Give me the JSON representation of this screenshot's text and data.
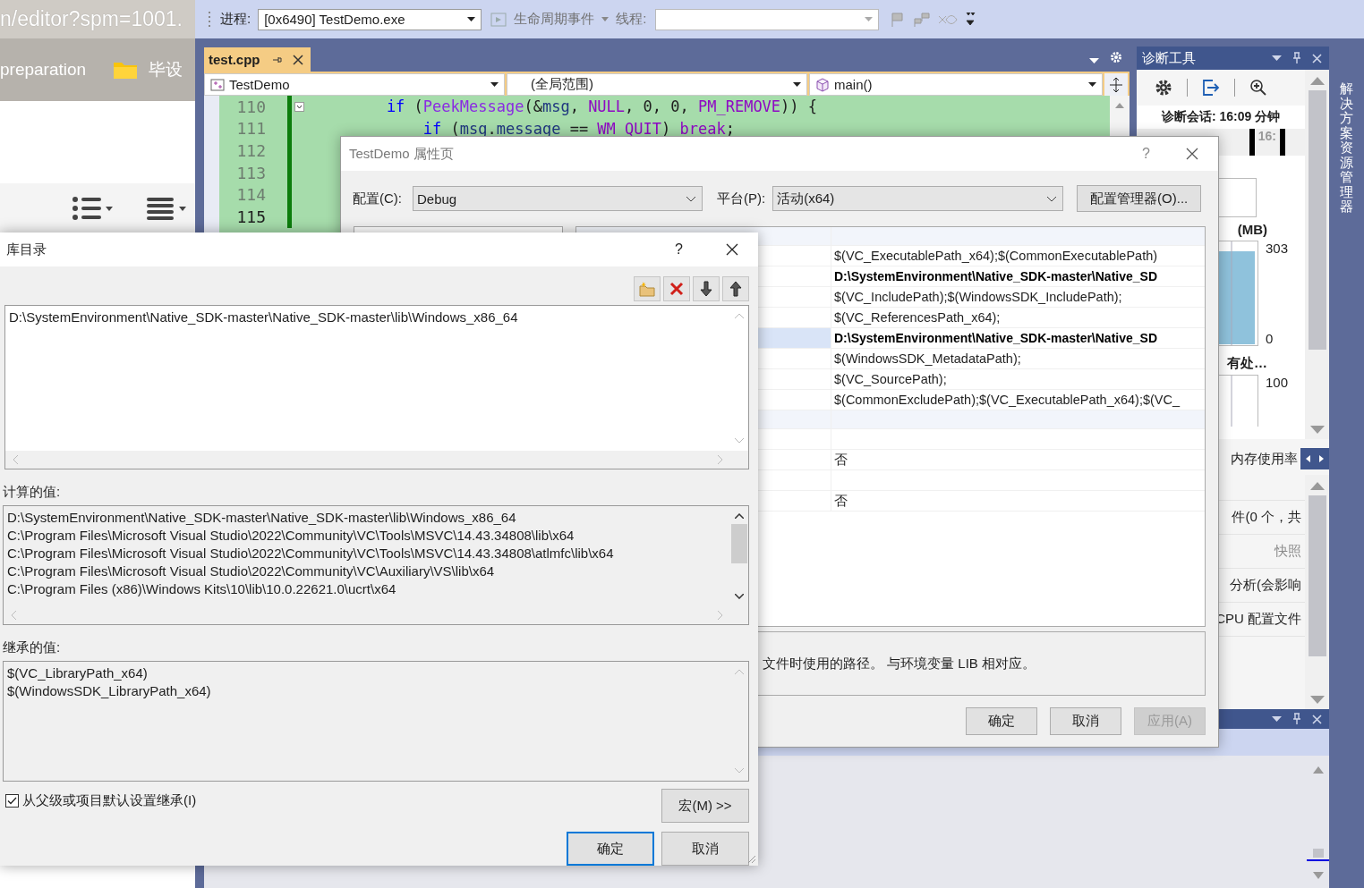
{
  "browser": {
    "url": "n/editor?spm=1001.",
    "bookmarks": [
      {
        "label": "preparation",
        "kind": "text"
      },
      {
        "label": "毕设",
        "kind": "folder"
      }
    ]
  },
  "vs": {
    "toolbar": {
      "process_label": "进程:",
      "process_value": "[0x6490] TestDemo.exe",
      "lifecycle": "生命周期事件",
      "thread_label": "线程:"
    },
    "tabs": [
      {
        "label": "test.cpp",
        "selected": true
      }
    ],
    "nav": {
      "project": "TestDemo",
      "scope": "(全局范围)",
      "member": "main()"
    },
    "code": [
      {
        "line": "110",
        "current": false,
        "tokens": [
          {
            "text": "if",
            "kind": "keyword"
          },
          {
            "text": " (",
            "kind": "plain"
          },
          {
            "text": "PeekMessage",
            "kind": "function"
          },
          {
            "text": "(&",
            "kind": "plain"
          },
          {
            "text": "msg",
            "kind": "variable"
          },
          {
            "text": ", ",
            "kind": "plain"
          },
          {
            "text": "NULL",
            "kind": "macro"
          },
          {
            "text": ", 0, 0, ",
            "kind": "plain"
          },
          {
            "text": "PM_REMOVE",
            "kind": "macro"
          },
          {
            "text": ")) {",
            "kind": "plain"
          }
        ]
      },
      {
        "line": "111",
        "current": false,
        "tokens": [
          {
            "text": "if",
            "kind": "keyword"
          },
          {
            "text": " (",
            "kind": "plain"
          },
          {
            "text": "msg",
            "kind": "variable"
          },
          {
            "text": ".",
            "kind": "plain"
          },
          {
            "text": "message",
            "kind": "variable"
          },
          {
            "text": " == ",
            "kind": "plain"
          },
          {
            "text": "WM_QUIT",
            "kind": "macro"
          },
          {
            "text": ") ",
            "kind": "plain"
          },
          {
            "text": "break",
            "kind": "control"
          },
          {
            "text": ";",
            "kind": "plain"
          }
        ]
      },
      {
        "line": "112",
        "current": false
      },
      {
        "line": "113",
        "current": false
      },
      {
        "line": "114",
        "current": false
      },
      {
        "line": "115",
        "current": true
      }
    ],
    "diagnostics": {
      "title": "诊断工具",
      "session": "诊断会话: 16:09 分钟",
      "timeline_label": "16:",
      "memory_label": "(MB)",
      "memory_max": "303",
      "memory_min": "0",
      "cpu_label": "有处…",
      "cpu_max": "100",
      "tab": "内存使用率",
      "items": [
        {
          "label": "件(0 个，共",
          "disabled": false
        },
        {
          "label": "快照",
          "disabled": true
        },
        {
          "label": "分析(会影响",
          "disabled": false
        },
        {
          "label": "CPU 配置文件",
          "disabled": false
        }
      ]
    },
    "side_tab": "解决方案资源管理器"
  },
  "properties": {
    "title": "TestDemo 属性页",
    "help": "?",
    "config_label": "配置(C):",
    "config": "Debug",
    "platform_label": "平台(P):",
    "platform": "活动(x64)",
    "manager_button": "配置管理器(O)...",
    "rows": [
      {
        "kind": "section"
      },
      {
        "kind": "value",
        "value": "$(VC_ExecutablePath_x64);$(CommonExecutablePath)",
        "bold": false,
        "selected": false
      },
      {
        "kind": "value",
        "value": "D:\\SystemEnvironment\\Native_SDK-master\\Native_SD",
        "bold": true,
        "selected": false
      },
      {
        "kind": "value",
        "value": "$(VC_IncludePath);$(WindowsSDK_IncludePath);",
        "bold": false,
        "selected": false
      },
      {
        "kind": "value",
        "value": "$(VC_ReferencesPath_x64);",
        "bold": false,
        "selected": false
      },
      {
        "kind": "value",
        "value": "D:\\SystemEnvironment\\Native_SDK-master\\Native_SD",
        "bold": true,
        "selected": true
      },
      {
        "kind": "value",
        "value": "$(WindowsSDK_MetadataPath);",
        "bold": false,
        "selected": false
      },
      {
        "kind": "value",
        "value": "$(VC_SourcePath);",
        "bold": false,
        "selected": false
      },
      {
        "kind": "value",
        "value": "$(CommonExcludePath);$(VC_ExecutablePath_x64);$(VC_",
        "bold": false,
        "selected": false
      },
      {
        "kind": "section"
      },
      {
        "kind": "value",
        "selected": false
      },
      {
        "kind": "value",
        "value": "否",
        "bold": false,
        "selected": false
      },
      {
        "kind": "value",
        "selected": false
      },
      {
        "kind": "value",
        "value": "否",
        "bold": false,
        "selected": false
      }
    ],
    "description": "文件时使用的路径。 与环境变量 LIB 相对应。",
    "buttons": [
      {
        "label": "确定",
        "disabled": false
      },
      {
        "label": "取消",
        "disabled": false
      },
      {
        "label": "应用(A)",
        "disabled": true
      }
    ]
  },
  "library": {
    "title": "库目录",
    "help": "?",
    "entries": [
      "D:\\SystemEnvironment\\Native_SDK-master\\Native_SDK-master\\lib\\Windows_x86_64"
    ],
    "computed_label": "计算的值:",
    "computed": [
      "D:\\SystemEnvironment\\Native_SDK-master\\Native_SDK-master\\lib\\Windows_x86_64",
      "C:\\Program Files\\Microsoft Visual Studio\\2022\\Community\\VC\\Tools\\MSVC\\14.43.34808\\lib\\x64",
      "C:\\Program Files\\Microsoft Visual Studio\\2022\\Community\\VC\\Tools\\MSVC\\14.43.34808\\atlmfc\\lib\\x64",
      "C:\\Program Files\\Microsoft Visual Studio\\2022\\Community\\VC\\Auxiliary\\VS\\lib\\x64",
      "C:\\Program Files (x86)\\Windows Kits\\10\\lib\\10.0.22621.0\\ucrt\\x64"
    ],
    "inherited_label": "继承的值:",
    "inherited": [
      "$(VC_LibraryPath_x64)",
      "$(WindowsSDK_LibraryPath_x64)"
    ],
    "inherit": {
      "label": "从父级或项目默认设置继承(I)",
      "checked": true
    },
    "macros_button": "宏(M) >>",
    "buttons": [
      {
        "label": "确定",
        "focused": true
      },
      {
        "label": "取消",
        "focused": false
      }
    ]
  }
}
